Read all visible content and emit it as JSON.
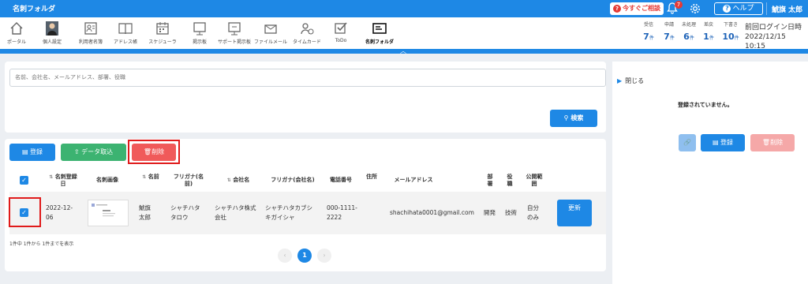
{
  "header": {
    "title": "名刺フォルダ",
    "consult_label": "今すぐご相談",
    "notification_count": "7",
    "help_label": "ヘルプ",
    "user_name": "鯱旗 太郎"
  },
  "nav": {
    "items": [
      {
        "label": "ポータル",
        "icon": "home-icon"
      },
      {
        "label": "個人設定",
        "icon": "avatar-icon"
      },
      {
        "label": "利用者名簿",
        "icon": "contacts-icon"
      },
      {
        "label": "アドレス帳",
        "icon": "address-book-icon"
      },
      {
        "label": "スケジューラ",
        "icon": "calendar-icon"
      },
      {
        "label": "掲示板",
        "icon": "board-icon"
      },
      {
        "label": "サポート掲示板",
        "icon": "support-board-icon"
      },
      {
        "label": "ファイルメール",
        "icon": "file-mail-icon"
      },
      {
        "label": "タイムカード",
        "icon": "timecard-icon"
      },
      {
        "label": "ToDo",
        "icon": "todo-icon"
      },
      {
        "label": "名刺フォルダ",
        "icon": "card-folder-icon"
      }
    ],
    "stats": [
      {
        "label": "受信",
        "value": "7",
        "unit": "件"
      },
      {
        "label": "申請",
        "value": "7",
        "unit": "件"
      },
      {
        "label": "未処理",
        "value": "6",
        "unit": "件"
      },
      {
        "label": "差戻",
        "value": "1",
        "unit": "件"
      },
      {
        "label": "下書き",
        "value": "10",
        "unit": "件"
      }
    ],
    "last_login_label": "前回ログイン日時",
    "last_login_value": "2022/12/15 10:15"
  },
  "search": {
    "placeholder": "名前、会社名、メールアドレス、部署、役職",
    "button_label": "検索"
  },
  "actions": {
    "register_label": "登録",
    "import_label": "データ取込",
    "delete_label": "削除"
  },
  "table": {
    "headers": {
      "date": "名刺登録日",
      "image": "名刺画像",
      "name": "名前",
      "furigana": "フリガナ(名前)",
      "company": "会社名",
      "company_furigana": "フリガナ(会社名)",
      "phone": "電話番号",
      "address": "住所",
      "email": "メールアドレス",
      "department": "部署",
      "position": "役職",
      "scope": "公開範囲"
    },
    "row": {
      "date": "2022-12-06",
      "name": "鯱旗太郎",
      "furigana": "シャチハタタロウ",
      "company": "シャチハタ株式会社",
      "company_furigana": "シャチハタカブシキガイシャ",
      "phone": "000-1111-2222",
      "address": "",
      "email": "shachihata0001@gmail.com",
      "department": "開発",
      "position": "技術",
      "scope": "自分のみ",
      "update_label": "更新"
    },
    "page_info": "1件中 1件から 1件までを表示",
    "current_page": "1"
  },
  "side_panel": {
    "close_label": "閉じる",
    "empty_message": "登録されていません。",
    "register_label": "登録",
    "delete_label": "削除"
  },
  "colors": {
    "primary": "#1e88e5",
    "success": "#3cb371",
    "danger": "#f05a5a",
    "highlight": "#e01b1b"
  }
}
